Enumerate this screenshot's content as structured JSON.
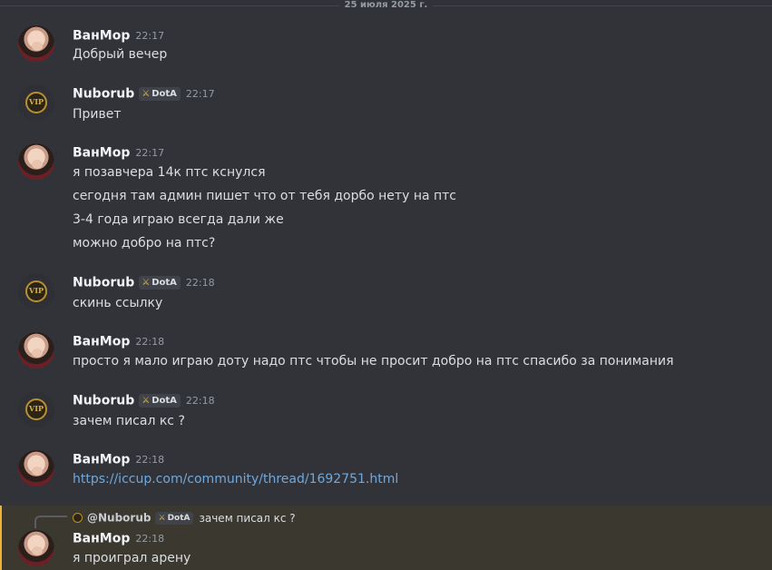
{
  "date_divider": "25 июля 2025 г.",
  "role_tag": "DotA",
  "messages": [
    {
      "author": "ВанМор",
      "time": "22:17",
      "lines": [
        "Добрый вечер"
      ]
    },
    {
      "author": "Nuborub",
      "time": "22:17",
      "lines": [
        "Привет"
      ]
    },
    {
      "author": "ВанМор",
      "time": "22:17",
      "lines": [
        "я позавчера 14к птс кснулся",
        "сегодня  там админ пишет что от тебя дорбо нету на птс",
        "3-4 года играю всегда дали же",
        "можно добро на птс?"
      ]
    },
    {
      "author": "Nuborub",
      "time": "22:18",
      "lines": [
        "скинь ссылку"
      ]
    },
    {
      "author": "ВанМор",
      "time": "22:18",
      "lines": [
        "просто я мало играю доту надо птс чтобы не просит добро на птс спасибо за  понимания"
      ]
    },
    {
      "author": "Nuborub",
      "time": "22:18",
      "lines": [
        "зачем писал кс ?"
      ]
    },
    {
      "author": "ВанМор",
      "time": "22:18",
      "lines": [
        "https://iccup.com/community/thread/1692751.html"
      ]
    },
    {
      "author": "ВанМор",
      "time": "22:18",
      "lines": [
        "я проиграл арену"
      ]
    }
  ],
  "reply": {
    "mention": "@Nuborub",
    "text": "зачем писал кс ?"
  },
  "colors": {
    "background": "#323339",
    "link": "#6fa8dc",
    "highlight_border": "#f0b232"
  }
}
